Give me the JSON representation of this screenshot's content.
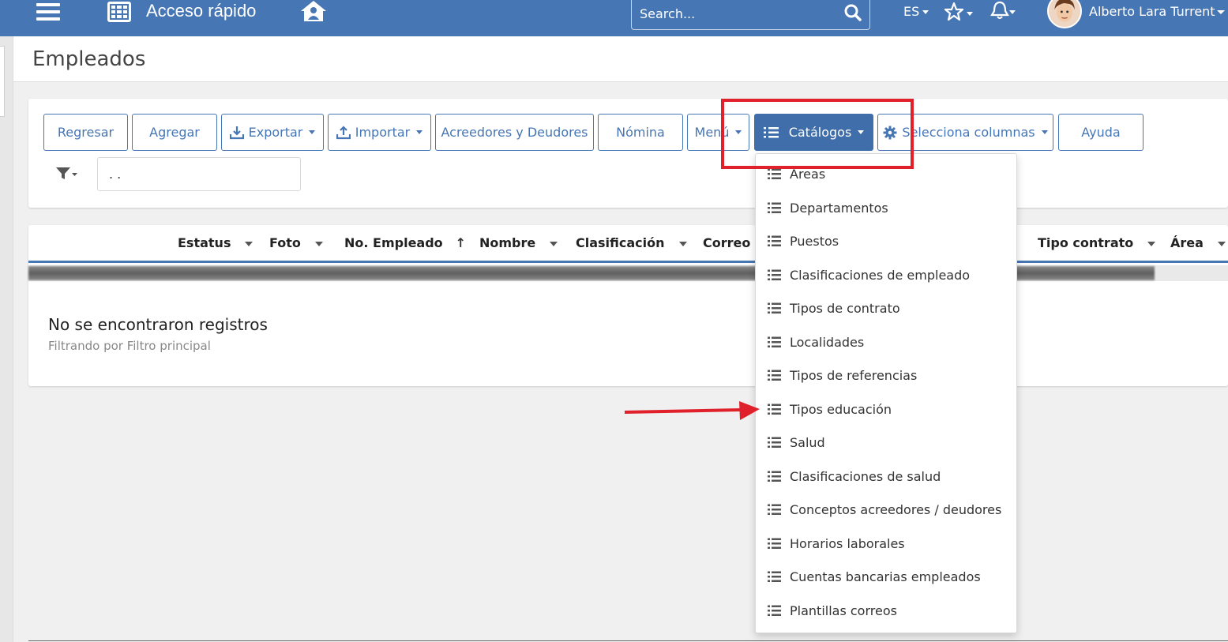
{
  "topbar": {
    "quick_access": "Acceso rápido",
    "search_placeholder": "Search...",
    "language": "ES",
    "user_name": "Alberto Lara Turrent",
    "bg_color": "#4776b4"
  },
  "page": {
    "title": "Empleados"
  },
  "toolbar": {
    "buttons": [
      {
        "label": "Regresar"
      },
      {
        "label": "Agregar"
      },
      {
        "label": "Exportar"
      },
      {
        "label": "Importar"
      },
      {
        "label": "Acreedores y Deudores"
      },
      {
        "label": "Nómina"
      },
      {
        "label": "Menú"
      },
      {
        "label": "Catálogos"
      },
      {
        "label": "Selecciona columnas"
      },
      {
        "label": "Ayuda"
      }
    ],
    "filter_value": ". ."
  },
  "table": {
    "columns": [
      {
        "label": "Estatus"
      },
      {
        "label": "Foto"
      },
      {
        "label": "No. Empleado"
      },
      {
        "label": "Nombre"
      },
      {
        "label": "Clasificación"
      },
      {
        "label": "Correo"
      },
      {
        "label": "Tipo contrato"
      },
      {
        "label": "Área"
      }
    ],
    "empty_title": "No se encontraron registros",
    "empty_subtitle": "Filtrando por Filtro principal"
  },
  "catalogos_menu": {
    "items": [
      {
        "label": "Áreas"
      },
      {
        "label": "Departamentos"
      },
      {
        "label": "Puestos"
      },
      {
        "label": "Clasificaciones de empleado"
      },
      {
        "label": "Tipos de contrato"
      },
      {
        "label": "Localidades"
      },
      {
        "label": "Tipos de referencias"
      },
      {
        "label": "Tipos educación"
      },
      {
        "label": "Salud"
      },
      {
        "label": "Clasificaciones de salud"
      },
      {
        "label": "Conceptos acreedores / deudores"
      },
      {
        "label": "Horarios laborales"
      },
      {
        "label": "Cuentas bancarias empleados"
      },
      {
        "label": "Plantillas correos"
      }
    ]
  },
  "annotation": {
    "highlight_color": "#e0202a"
  }
}
